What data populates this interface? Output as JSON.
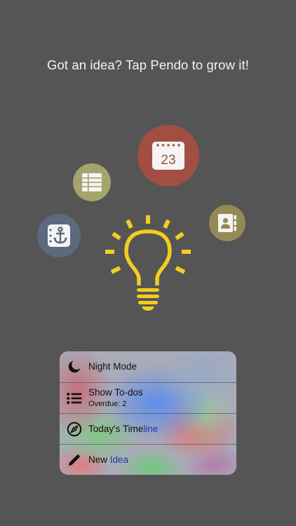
{
  "header": {
    "text": "Got an idea? Tap Pendo to grow it!"
  },
  "circles": {
    "anchor": {
      "icon": "anchor-icon",
      "color": "#5c6a7e"
    },
    "list": {
      "icon": "list-grid-icon",
      "color": "#a4a56d"
    },
    "calendar": {
      "icon": "calendar-icon",
      "color": "#a24e43",
      "day": "23"
    },
    "contact": {
      "icon": "contact-card-icon",
      "color": "#958a55"
    }
  },
  "bulb": {
    "icon": "lightbulb-icon",
    "color": "#f2cd21"
  },
  "menu": {
    "night_mode": {
      "label": "Night Mode",
      "icon": "moon-icon"
    },
    "show_todos": {
      "label": "Show To-dos",
      "sub": "Overdue: 2",
      "icon": "list-icon"
    },
    "timeline": {
      "label": "Today's Time",
      "label_accent": "line",
      "icon": "compass-icon"
    },
    "new_idea": {
      "label": "New ",
      "label_accent": "Idea",
      "icon": "pencil-icon"
    }
  }
}
